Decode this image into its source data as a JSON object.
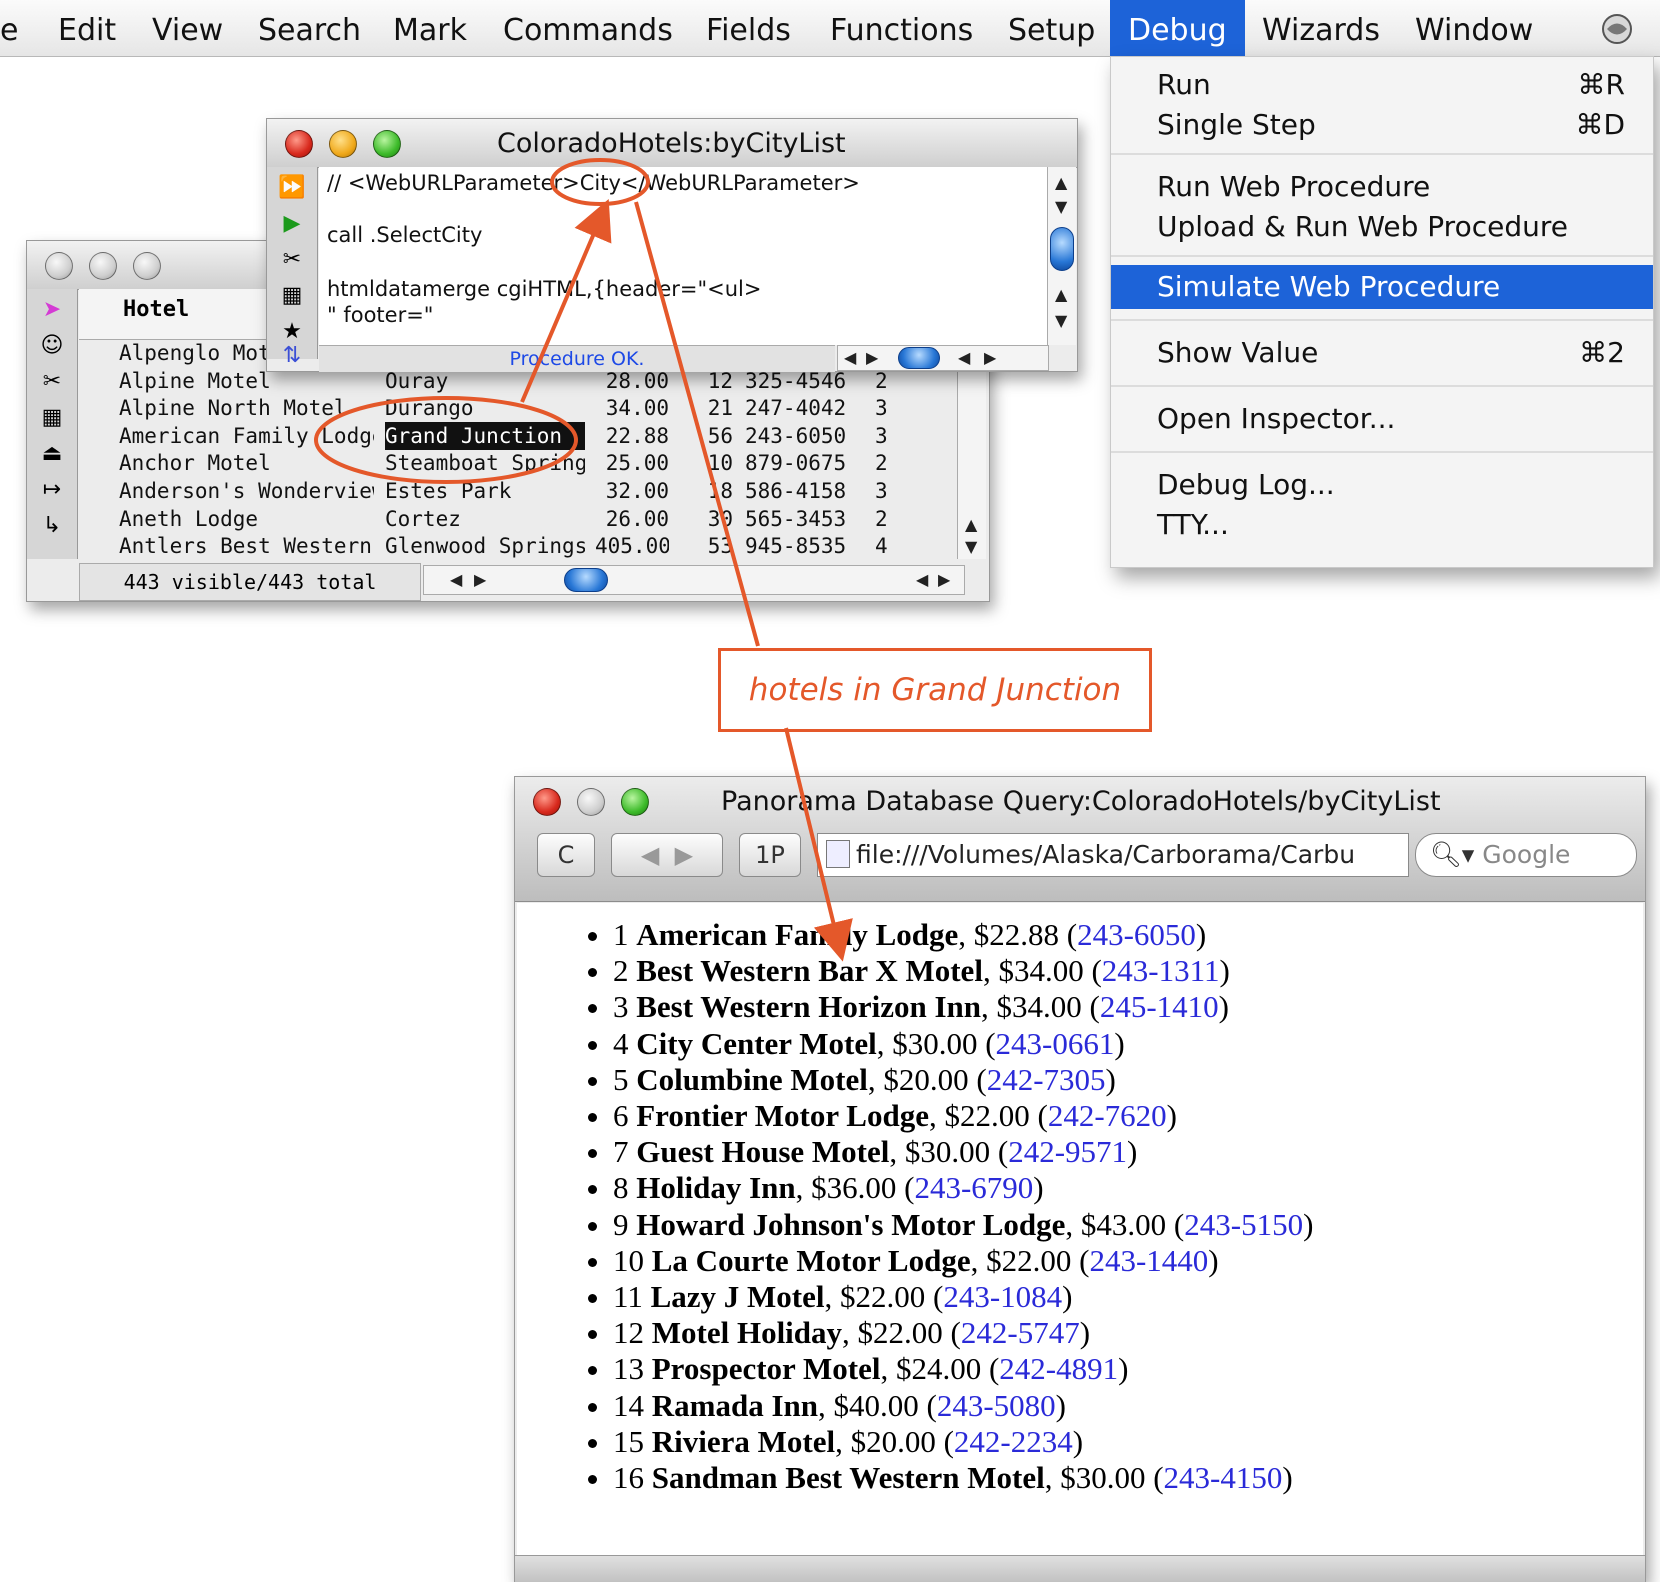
{
  "menubar": {
    "items": [
      "e",
      "Edit",
      "View",
      "Search",
      "Mark",
      "Commands",
      "Fields",
      "Functions",
      "Setup",
      "Debug",
      "Wizards",
      "Window"
    ],
    "active": "Debug"
  },
  "debug_menu": {
    "items": [
      {
        "label": "Run",
        "shortcut": "⌘R"
      },
      {
        "label": "Single Step",
        "shortcut": "⌘D"
      },
      {
        "label": "Run Web Procedure",
        "shortcut": ""
      },
      {
        "label": "Upload & Run Web Procedure",
        "shortcut": ""
      },
      {
        "label": "Simulate Web Procedure",
        "shortcut": "",
        "highlighted": true
      },
      {
        "label": "Show Value",
        "shortcut": "⌘2"
      },
      {
        "label": "Open Inspector...",
        "shortcut": ""
      },
      {
        "label": "Debug Log...",
        "shortcut": ""
      },
      {
        "label": "TTY...",
        "shortcut": ""
      }
    ]
  },
  "procedure_window": {
    "title": "ColoradoHotels:byCityList",
    "lines": [
      "// <WebURLParameter>City</WebURLParameter>",
      "call .SelectCity",
      "htmldatamerge cgiHTML,{header=\"<ul>",
      "\" footer=\""
    ],
    "status": "Procedure OK."
  },
  "data_window": {
    "column_header": "Hotel",
    "rows": [
      {
        "hotel": "Alpenglo Motor Lodge",
        "city": "",
        "rate": "",
        "rooms": "",
        "phone": "",
        "stars": ""
      },
      {
        "hotel": "Alpine Motel",
        "city": "Ouray",
        "rate": "28.00",
        "rooms": "12",
        "phone": "325-4546",
        "stars": "2"
      },
      {
        "hotel": "Alpine North Motel",
        "city": "Durango",
        "rate": "34.00",
        "rooms": "21",
        "phone": "247-4042",
        "stars": "3"
      },
      {
        "hotel": "American Family Lodge",
        "city": "Grand Junction",
        "rate": "22.88",
        "rooms": "56",
        "phone": "243-6050",
        "stars": "3"
      },
      {
        "hotel": "Anchor Motel",
        "city": "Steamboat Springs",
        "rate": "25.00",
        "rooms": "10",
        "phone": "879-0675",
        "stars": "2"
      },
      {
        "hotel": "Anderson's Wonderview",
        "city": "Estes Park",
        "rate": "32.00",
        "rooms": "18",
        "phone": "586-4158",
        "stars": "3"
      },
      {
        "hotel": "Aneth Lodge",
        "city": "Cortez",
        "rate": "26.00",
        "rooms": "30",
        "phone": "565-3453",
        "stars": "2"
      },
      {
        "hotel": "Antlers Best Western Motel",
        "city": "Glenwood Springs",
        "rate": "405.00",
        "rooms": "53",
        "phone": "945-8535",
        "stars": "4"
      }
    ],
    "status": "443 visible/443 total"
  },
  "annotation": {
    "text": "hotels in Grand Junction",
    "color": "#e4582a"
  },
  "browser": {
    "title": "Panorama Database Query:ColoradoHotels/byCityList",
    "url": "file:///Volumes/Alaska/Carborama/Carbu",
    "search_placeholder": "Google",
    "reload_label": "C",
    "tab_label": "1P",
    "results": [
      {
        "num": "1",
        "name": "American Family Lodge",
        "price": "$22.88",
        "phone": "243-6050"
      },
      {
        "num": "2",
        "name": "Best Western Bar X Motel",
        "price": "$34.00",
        "phone": "243-1311"
      },
      {
        "num": "3",
        "name": "Best Western Horizon Inn",
        "price": "$34.00",
        "phone": "245-1410"
      },
      {
        "num": "4",
        "name": "City Center Motel",
        "price": "$30.00",
        "phone": "243-0661"
      },
      {
        "num": "5",
        "name": "Columbine Motel",
        "price": "$20.00",
        "phone": "242-7305"
      },
      {
        "num": "6",
        "name": "Frontier Motor Lodge",
        "price": "$22.00",
        "phone": "242-7620"
      },
      {
        "num": "7",
        "name": "Guest House Motel",
        "price": "$30.00",
        "phone": "242-9571"
      },
      {
        "num": "8",
        "name": "Holiday Inn",
        "price": "$36.00",
        "phone": "243-6790"
      },
      {
        "num": "9",
        "name": "Howard Johnson's Motor Lodge",
        "price": "$43.00",
        "phone": "243-5150"
      },
      {
        "num": "10",
        "name": "La Courte Motor Lodge",
        "price": "$22.00",
        "phone": "243-1440"
      },
      {
        "num": "11",
        "name": "Lazy J Motel",
        "price": "$22.00",
        "phone": "243-1084"
      },
      {
        "num": "12",
        "name": "Motel Holiday",
        "price": "$22.00",
        "phone": "242-5747"
      },
      {
        "num": "13",
        "name": "Prospector Motel",
        "price": "$24.00",
        "phone": "242-4891"
      },
      {
        "num": "14",
        "name": "Ramada Inn",
        "price": "$40.00",
        "phone": "243-5080"
      },
      {
        "num": "15",
        "name": "Riviera Motel",
        "price": "$20.00",
        "phone": "242-2234"
      },
      {
        "num": "16",
        "name": "Sandman Best Western Motel",
        "price": "$30.00",
        "phone": "243-4150"
      }
    ]
  }
}
